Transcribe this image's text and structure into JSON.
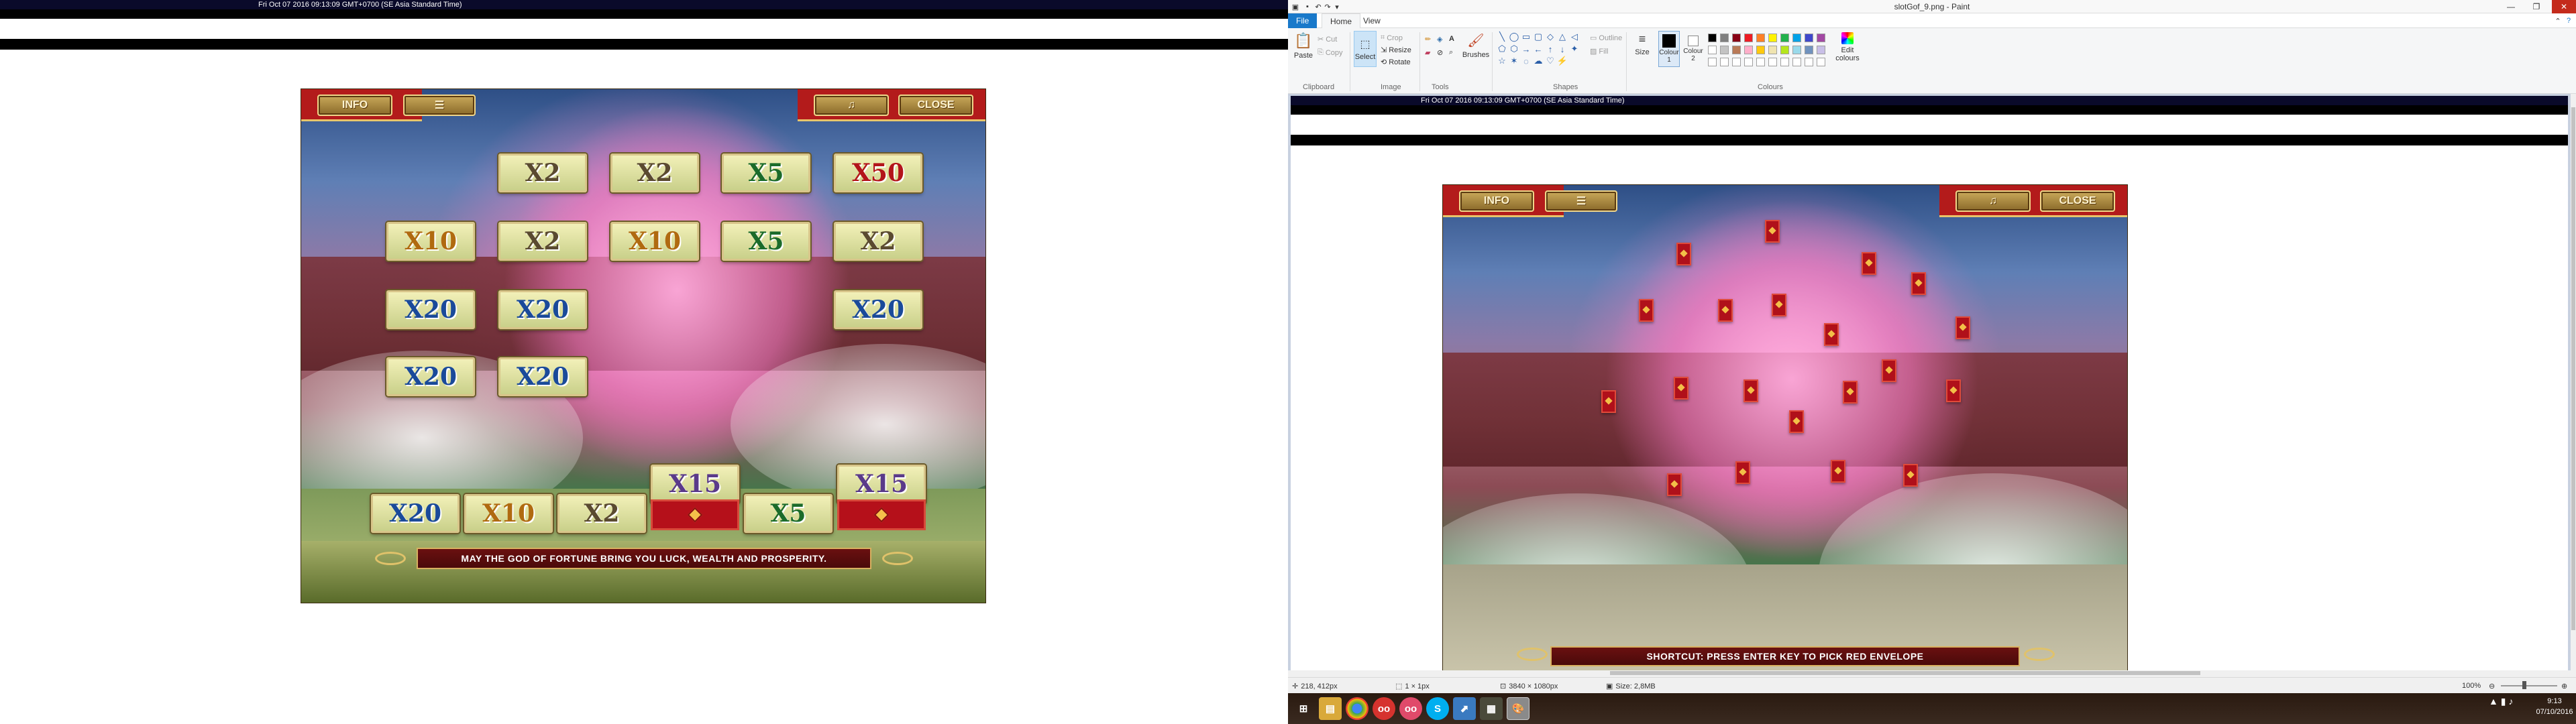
{
  "left": {
    "timestamp": "Fri Oct 07 2016 09:13:09 GMT+0700 (SE Asia Standard Time)",
    "buttons": {
      "info": "INFO",
      "sound_icon": "music-note-icon",
      "close": "CLOSE"
    },
    "tiles": [
      {
        "label": "X2",
        "color": "c-brown"
      },
      {
        "label": "X2",
        "color": "c-brown"
      },
      {
        "label": "X5",
        "color": "c-green"
      },
      {
        "label": "X50",
        "color": "c-red"
      },
      {
        "label": "X10",
        "color": "c-orange"
      },
      {
        "label": "X2",
        "color": "c-brown"
      },
      {
        "label": "X10",
        "color": "c-orange"
      },
      {
        "label": "X5",
        "color": "c-green"
      },
      {
        "label": "X2",
        "color": "c-brown"
      },
      {
        "label": "X20",
        "color": "c-blue"
      },
      {
        "label": "X20",
        "color": "c-blue"
      },
      {
        "label": "X20",
        "color": "c-blue"
      },
      {
        "label": "X20",
        "color": "c-blue"
      },
      {
        "label": "X20",
        "color": "c-blue"
      }
    ],
    "bottom_tiles": [
      {
        "label": "X20",
        "color": "c-blue"
      },
      {
        "label": "X10",
        "color": "c-orange"
      },
      {
        "label": "X2",
        "color": "c-brown"
      },
      {
        "label": "X15",
        "color": "c-purple"
      },
      {
        "label": "X5",
        "color": "c-green"
      },
      {
        "label": "X15",
        "color": "c-purple"
      }
    ],
    "message": "MAY THE GOD OF FORTUNE BRING YOU LUCK, WEALTH AND PROSPERITY."
  },
  "paint": {
    "window_title": "slotGof_9.png - Paint",
    "tabs": [
      "File",
      "Home",
      "View"
    ],
    "clipboard": {
      "paste": "Paste",
      "cut": "Cut",
      "copy": "Copy",
      "group": "Clipboard"
    },
    "image": {
      "select": "Select",
      "crop": "Crop",
      "resize": "Resize",
      "rotate": "Rotate",
      "group": "Image"
    },
    "tools": {
      "group": "Tools",
      "brushes": "Brushes"
    },
    "shapes": {
      "group": "Shapes",
      "outline": "Outline",
      "fill": "Fill"
    },
    "size_label": "Size",
    "colour1": "Colour 1",
    "colour2": "Colour 2",
    "colours_group": "Colours",
    "edit_colours": "Edit colours",
    "palette_row1": [
      "#000000",
      "#7f7f7f",
      "#880015",
      "#ed1c24",
      "#ff7f27",
      "#fff200",
      "#22b14c",
      "#00a2e8",
      "#3f48cc",
      "#a349a4"
    ],
    "palette_row2": [
      "#ffffff",
      "#c3c3c3",
      "#b97a57",
      "#ffaec9",
      "#ffc90e",
      "#efe4b0",
      "#b5e61d",
      "#99d9ea",
      "#7092be",
      "#c8bfe7"
    ],
    "canvas_timestamp": "Fri Oct 07 2016 09:13:09 GMT+0700 (SE Asia Standard Time)",
    "game_buttons": {
      "info": "INFO",
      "close": "CLOSE"
    },
    "shortcut": "SHORTCUT: PRESS ENTER KEY TO PICK RED ENVELOPE",
    "status": {
      "cursor": "218, 412px",
      "selection": "1 × 1px",
      "dimensions": "3840 × 1080px",
      "size": "Size: 2,8MB",
      "zoom": "100%"
    }
  },
  "taskbar": {
    "time": "9:13",
    "date": "07/10/2016",
    "apps": [
      "start-icon",
      "file-explorer-icon",
      "chrome-icon",
      "app-red-icon",
      "app-red2-icon",
      "skype-icon",
      "app-blue-icon",
      "app-dark-icon",
      "paint-icon"
    ]
  }
}
